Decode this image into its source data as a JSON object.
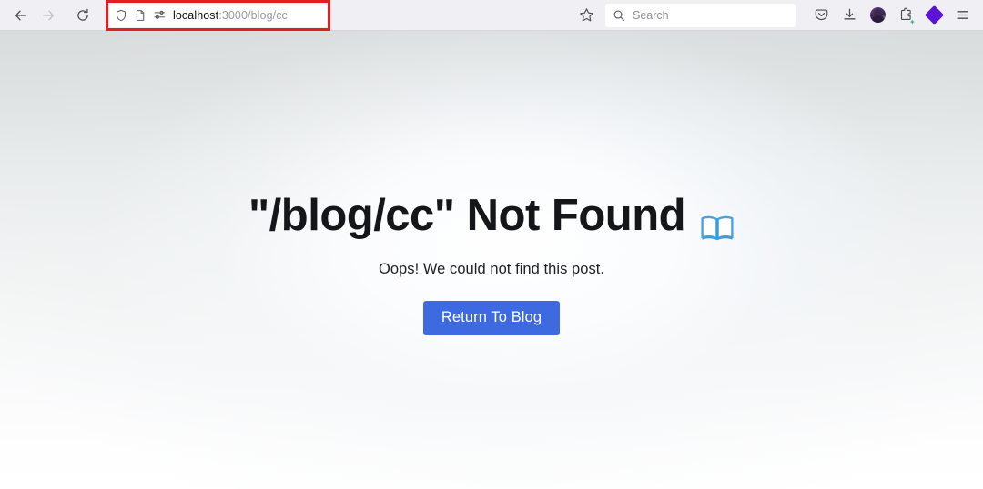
{
  "browser": {
    "nav": {
      "back_icon": "arrow-left-icon",
      "forward_icon": "arrow-right-icon",
      "reload_icon": "reload-icon"
    },
    "urlbar": {
      "shield_icon": "shield-icon",
      "page_icon": "page-icon",
      "permissions_icon": "sliders-icon",
      "url_host": "localhost",
      "url_path": ":3000/blog/cc",
      "full_url": "localhost:3000/blog/cc",
      "highlight_color": "#e02020"
    },
    "bookmark": {
      "icon": "star-icon"
    },
    "search": {
      "icon": "search-icon",
      "placeholder": "Search"
    },
    "toolbar_right": [
      {
        "name": "pocket-icon",
        "label": "Save to Pocket"
      },
      {
        "name": "download-icon",
        "label": "Downloads"
      },
      {
        "name": "avatar",
        "label": "Account"
      },
      {
        "name": "extensions-icon",
        "label": "Extensions"
      },
      {
        "name": "diamond-extension-icon",
        "label": "Extension"
      },
      {
        "name": "hamburger-menu-icon",
        "label": "Open application menu"
      }
    ],
    "chrome_bg": "#f0f0f4"
  },
  "page": {
    "heading": "\"/blog/cc\" Not Found",
    "heading_emoji": "open-book-emoji",
    "subtitle": "Oops! We could not find this post.",
    "return_button_label": "Return To Blog",
    "accent_color": "#3e6ae1",
    "background_top": "#d9dcdc",
    "background_bottom": "#ffffff"
  }
}
